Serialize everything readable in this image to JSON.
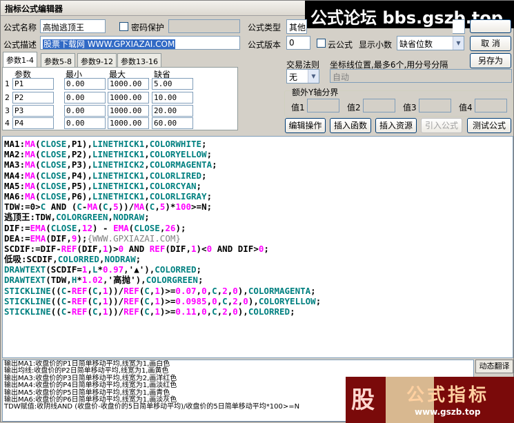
{
  "window": {
    "title": "指标公式编辑器"
  },
  "watermark_top": "公式论坛 bbs.gszb.top",
  "watermark_bottom": {
    "glyph": "股",
    "text": "公式指标",
    "url": "www.gszb.top"
  },
  "form": {
    "name_label": "公式名称",
    "name_value": "高抛逃顶王",
    "password_label": "密码保护",
    "type_label": "公式类型",
    "type_value": "其他类",
    "desc_label": "公式描述",
    "desc_value": "股票下载网 WWW.GPXIAZAI.COM",
    "version_label": "公式版本",
    "version_value": "0",
    "cloud_label": "云公式",
    "decimals_label": "显示小数",
    "decimals_value": "缺省位数"
  },
  "buttons": {
    "cancel": "取  消",
    "save_as": "另存为",
    "edit_op": "编辑操作",
    "insert_func": "插入函数",
    "insert_res": "插入资源",
    "import_formula": "引入公式",
    "test_formula": "测试公式",
    "dyn_translate": "动态翻译"
  },
  "tabs": [
    "参数1-4",
    "参数5-8",
    "参数9-12",
    "参数13-16"
  ],
  "params": {
    "headers": [
      "参数",
      "最小",
      "最大",
      "缺省"
    ],
    "rows": [
      {
        "idx": "1",
        "name": "P1",
        "min": "0.00",
        "max": "1000.00",
        "def": "5.00"
      },
      {
        "idx": "2",
        "name": "P2",
        "min": "0.00",
        "max": "1000.00",
        "def": "10.00"
      },
      {
        "idx": "3",
        "name": "P3",
        "min": "0.00",
        "max": "1000.00",
        "def": "20.00"
      },
      {
        "idx": "4",
        "name": "P4",
        "min": "0.00",
        "max": "1000.00",
        "def": "60.00"
      }
    ]
  },
  "trade": {
    "rule_label": "交易法则",
    "rule_value": "无",
    "axis_label": "坐标线位置,最多6个,用分号分隔",
    "axis_value": "自动",
    "extra_y_label": "额外Y轴分界",
    "v1": "值1",
    "v2": "值2",
    "v3": "值3",
    "v4": "值4"
  },
  "code": [
    [
      [
        "k",
        "MA1:"
      ],
      [
        "f",
        "MA"
      ],
      [
        "k",
        "("
      ],
      [
        "c",
        "CLOSE"
      ],
      [
        "k",
        ",P1),"
      ],
      [
        "c",
        "LINETHICK1"
      ],
      [
        "k",
        ","
      ],
      [
        "c",
        "COLORWHITE"
      ],
      [
        "k",
        ";"
      ]
    ],
    [
      [
        "k",
        "MA2:"
      ],
      [
        "f",
        "MA"
      ],
      [
        "k",
        "("
      ],
      [
        "c",
        "CLOSE"
      ],
      [
        "k",
        ",P2),"
      ],
      [
        "c",
        "LINETHICK1"
      ],
      [
        "k",
        ","
      ],
      [
        "c",
        "COLORYELLOW"
      ],
      [
        "k",
        ";"
      ]
    ],
    [
      [
        "k",
        "MA3:"
      ],
      [
        "f",
        "MA"
      ],
      [
        "k",
        "("
      ],
      [
        "c",
        "CLOSE"
      ],
      [
        "k",
        ",P3),"
      ],
      [
        "c",
        "LINETHICK2"
      ],
      [
        "k",
        ","
      ],
      [
        "c",
        "COLORMAGENTA"
      ],
      [
        "k",
        ";"
      ]
    ],
    [
      [
        "k",
        "MA4:"
      ],
      [
        "f",
        "MA"
      ],
      [
        "k",
        "("
      ],
      [
        "c",
        "CLOSE"
      ],
      [
        "k",
        ",P4),"
      ],
      [
        "c",
        "LINETHICK1"
      ],
      [
        "k",
        ","
      ],
      [
        "c",
        "COLORLIRED"
      ],
      [
        "k",
        ";"
      ]
    ],
    [
      [
        "k",
        "MA5:"
      ],
      [
        "f",
        "MA"
      ],
      [
        "k",
        "("
      ],
      [
        "c",
        "CLOSE"
      ],
      [
        "k",
        ",P5),"
      ],
      [
        "c",
        "LINETHICK1"
      ],
      [
        "k",
        ","
      ],
      [
        "c",
        "COLORCYAN"
      ],
      [
        "k",
        ";"
      ]
    ],
    [
      [
        "k",
        "MA6:"
      ],
      [
        "f",
        "MA"
      ],
      [
        "k",
        "("
      ],
      [
        "c",
        "CLOSE"
      ],
      [
        "k",
        ",P6),"
      ],
      [
        "c",
        "LINETHICK1"
      ],
      [
        "k",
        ","
      ],
      [
        "c",
        "COLORLIGRAY"
      ],
      [
        "k",
        ";"
      ]
    ],
    [
      [
        "k",
        "TDW:=0>"
      ],
      [
        "c",
        "C"
      ],
      [
        "k",
        " AND ("
      ],
      [
        "c",
        "C"
      ],
      [
        "k",
        "-"
      ],
      [
        "f",
        "MA"
      ],
      [
        "k",
        "("
      ],
      [
        "c",
        "C"
      ],
      [
        "k",
        ","
      ],
      [
        "n",
        "5"
      ],
      [
        "k",
        "))/"
      ],
      [
        "f",
        "MA"
      ],
      [
        "k",
        "("
      ],
      [
        "c",
        "C"
      ],
      [
        "k",
        ","
      ],
      [
        "n",
        "5"
      ],
      [
        "k",
        ")*"
      ],
      [
        "n",
        "100"
      ],
      [
        "k",
        ">=N;"
      ]
    ],
    [
      [
        "s",
        "逃顶王:TDW,"
      ],
      [
        "c",
        "COLORGREEN"
      ],
      [
        "k",
        ","
      ],
      [
        "c",
        "NODRAW"
      ],
      [
        "k",
        ";"
      ]
    ],
    [
      [
        "k",
        "DIF:="
      ],
      [
        "f",
        "EMA"
      ],
      [
        "k",
        "("
      ],
      [
        "c",
        "CLOSE"
      ],
      [
        "k",
        ","
      ],
      [
        "n",
        "12"
      ],
      [
        "k",
        ") - "
      ],
      [
        "f",
        "EMA"
      ],
      [
        "k",
        "("
      ],
      [
        "c",
        "CLOSE"
      ],
      [
        "k",
        ","
      ],
      [
        "n",
        "26"
      ],
      [
        "k",
        ");"
      ]
    ],
    [
      [
        "k",
        "DEA:="
      ],
      [
        "f",
        "EMA"
      ],
      [
        "k",
        "(DIF,"
      ],
      [
        "n",
        "9"
      ],
      [
        "k",
        ");"
      ],
      [
        "gray",
        "{WWW.GPXIAZAI.COM}"
      ]
    ],
    [
      [
        "k",
        "SCDIF:=DIF-"
      ],
      [
        "f",
        "REF"
      ],
      [
        "k",
        "(DIF,"
      ],
      [
        "n",
        "1"
      ],
      [
        "k",
        ")>"
      ],
      [
        "n",
        "0"
      ],
      [
        "k",
        " AND "
      ],
      [
        "f",
        "REF"
      ],
      [
        "k",
        "(DIF,"
      ],
      [
        "n",
        "1"
      ],
      [
        "k",
        ")<"
      ],
      [
        "n",
        "0"
      ],
      [
        "k",
        " AND DIF>"
      ],
      [
        "n",
        "0"
      ],
      [
        "k",
        ";"
      ]
    ],
    [
      [
        "s",
        "低吸:SCDIF,"
      ],
      [
        "c",
        "COLORRED"
      ],
      [
        "k",
        ","
      ],
      [
        "c",
        "NODRAW"
      ],
      [
        "k",
        ";"
      ]
    ],
    [
      [
        "c",
        "DRAWTEXT"
      ],
      [
        "k",
        "(SCDIF="
      ],
      [
        "n",
        "1"
      ],
      [
        "k",
        ","
      ],
      [
        "c",
        "L"
      ],
      [
        "k",
        "*"
      ],
      [
        "n",
        "0.97"
      ],
      [
        "k",
        ",'▲'),"
      ],
      [
        "c",
        "COLORRED"
      ],
      [
        "k",
        ";"
      ]
    ],
    [
      [
        "c",
        "DRAWTEXT"
      ],
      [
        "k",
        "(TDW,"
      ],
      [
        "c",
        "H"
      ],
      [
        "k",
        "*"
      ],
      [
        "n",
        "1.02"
      ],
      [
        "k",
        ",'高抛'),"
      ],
      [
        "c",
        "COLORGREEN"
      ],
      [
        "k",
        ";"
      ]
    ],
    [
      [
        "c",
        "STICKLINE"
      ],
      [
        "k",
        "(("
      ],
      [
        "c",
        "C"
      ],
      [
        "k",
        "-"
      ],
      [
        "f",
        "REF"
      ],
      [
        "k",
        "("
      ],
      [
        "c",
        "C"
      ],
      [
        "k",
        ","
      ],
      [
        "n",
        "1"
      ],
      [
        "k",
        "))/"
      ],
      [
        "f",
        "REF"
      ],
      [
        "k",
        "("
      ],
      [
        "c",
        "C"
      ],
      [
        "k",
        ","
      ],
      [
        "n",
        "1"
      ],
      [
        "k",
        ")>="
      ],
      [
        "n",
        "0.07"
      ],
      [
        "k",
        ","
      ],
      [
        "n",
        "0"
      ],
      [
        "k",
        ","
      ],
      [
        "c",
        "C"
      ],
      [
        "k",
        ","
      ],
      [
        "n",
        "2"
      ],
      [
        "k",
        ","
      ],
      [
        "n",
        "0"
      ],
      [
        "k",
        "),"
      ],
      [
        "c",
        "COLORMAGENTA"
      ],
      [
        "k",
        ";"
      ]
    ],
    [
      [
        "c",
        "STICKLINE"
      ],
      [
        "k",
        "(("
      ],
      [
        "c",
        "C"
      ],
      [
        "k",
        "-"
      ],
      [
        "f",
        "REF"
      ],
      [
        "k",
        "("
      ],
      [
        "c",
        "C"
      ],
      [
        "k",
        ","
      ],
      [
        "n",
        "1"
      ],
      [
        "k",
        "))/"
      ],
      [
        "f",
        "REF"
      ],
      [
        "k",
        "("
      ],
      [
        "c",
        "C"
      ],
      [
        "k",
        ","
      ],
      [
        "n",
        "1"
      ],
      [
        "k",
        ")>="
      ],
      [
        "n",
        "0.0985"
      ],
      [
        "k",
        ","
      ],
      [
        "n",
        "0"
      ],
      [
        "k",
        ","
      ],
      [
        "c",
        "C"
      ],
      [
        "k",
        ","
      ],
      [
        "n",
        "2"
      ],
      [
        "k",
        ","
      ],
      [
        "n",
        "0"
      ],
      [
        "k",
        "),"
      ],
      [
        "c",
        "COLORYELLOW"
      ],
      [
        "k",
        ";"
      ]
    ],
    [
      [
        "c",
        "STICKLINE"
      ],
      [
        "k",
        "(("
      ],
      [
        "c",
        "C"
      ],
      [
        "k",
        "-"
      ],
      [
        "f",
        "REF"
      ],
      [
        "k",
        "("
      ],
      [
        "c",
        "C"
      ],
      [
        "k",
        ","
      ],
      [
        "n",
        "1"
      ],
      [
        "k",
        "))/"
      ],
      [
        "f",
        "REF"
      ],
      [
        "k",
        "("
      ],
      [
        "c",
        "C"
      ],
      [
        "k",
        ","
      ],
      [
        "n",
        "1"
      ],
      [
        "k",
        ")>="
      ],
      [
        "n",
        "0.11"
      ],
      [
        "k",
        ","
      ],
      [
        "n",
        "0"
      ],
      [
        "k",
        ","
      ],
      [
        "c",
        "C"
      ],
      [
        "k",
        ","
      ],
      [
        "n",
        "2"
      ],
      [
        "k",
        ","
      ],
      [
        "n",
        "0"
      ],
      [
        "k",
        "),"
      ],
      [
        "c",
        "COLORRED"
      ],
      [
        "k",
        ";"
      ]
    ]
  ],
  "output": [
    "输出MA1:收盘价的P1日简单移动平均,线宽为1,画白色",
    "输出均线:收盘价的P2日简单移动平均,线宽为1,画黄色",
    "输出MA3:收盘价的P3日简单移动平均,线宽为2,画洋红色",
    "输出MA4:收盘价的P4日简单移动平均,线宽为1,画淡红色",
    "输出MA5:收盘价的P5日简单移动平均,线宽为1,画青色",
    "输出MA6:收盘价的P6日简单移动平均,线宽为1,画淡灰色",
    "TDW赋值:收阴线AND (收盘价-收盘价的5日简单移动平均)/收盘价的5日简单移动平均*100>=N"
  ]
}
